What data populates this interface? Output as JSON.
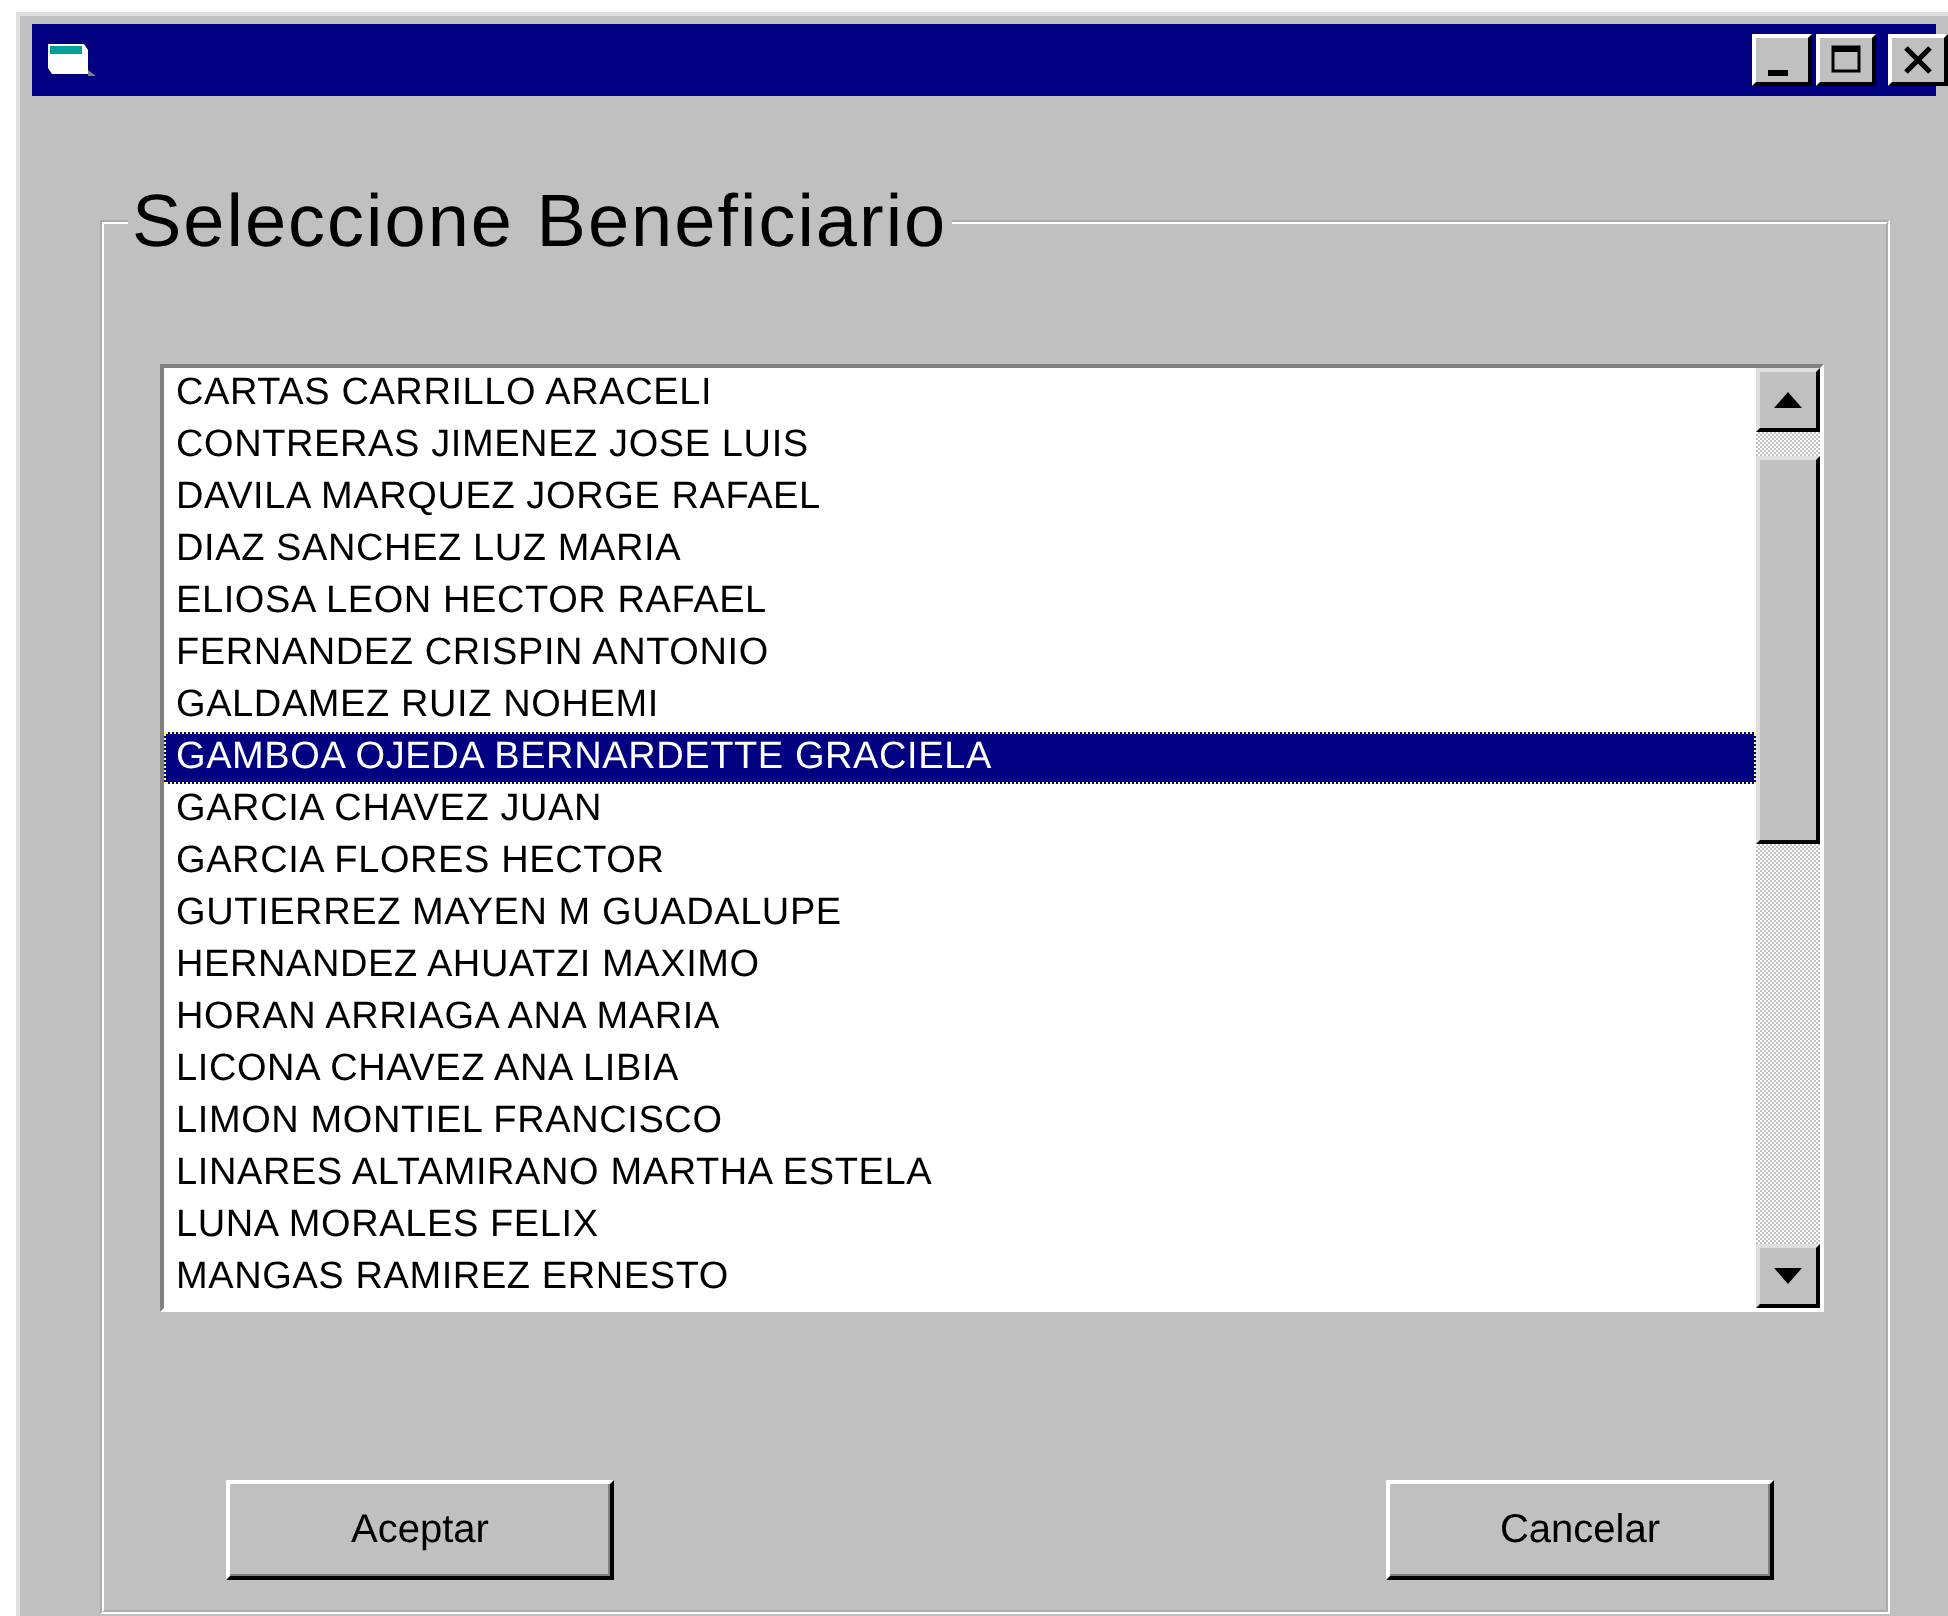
{
  "group_title": "Seleccione Beneficiario",
  "list_items": [
    {
      "label": "CARTAS CARRILLO ARACELI",
      "selected": false
    },
    {
      "label": "CONTRERAS JIMENEZ JOSE LUIS",
      "selected": false
    },
    {
      "label": "DAVILA MARQUEZ JORGE RAFAEL",
      "selected": false
    },
    {
      "label": "DIAZ SANCHEZ LUZ MARIA",
      "selected": false
    },
    {
      "label": "ELIOSA LEON HECTOR RAFAEL",
      "selected": false
    },
    {
      "label": "FERNANDEZ CRISPIN ANTONIO",
      "selected": false
    },
    {
      "label": "GALDAMEZ RUIZ NOHEMI",
      "selected": false
    },
    {
      "label": "GAMBOA OJEDA BERNARDETTE GRACIELA",
      "selected": true
    },
    {
      "label": "GARCIA CHAVEZ JUAN",
      "selected": false
    },
    {
      "label": "GARCIA FLORES HECTOR",
      "selected": false
    },
    {
      "label": "GUTIERREZ MAYEN M GUADALUPE",
      "selected": false
    },
    {
      "label": "HERNANDEZ AHUATZI MAXIMO",
      "selected": false
    },
    {
      "label": "HORAN ARRIAGA ANA MARIA",
      "selected": false
    },
    {
      "label": "LICONA CHAVEZ ANA LIBIA",
      "selected": false
    },
    {
      "label": "LIMON MONTIEL FRANCISCO",
      "selected": false
    },
    {
      "label": "LINARES ALTAMIRANO MARTHA ESTELA",
      "selected": false
    },
    {
      "label": "LUNA MORALES FELIX",
      "selected": false
    },
    {
      "label": "MANGAS RAMIREZ ERNESTO",
      "selected": false
    }
  ],
  "buttons": [
    {
      "label": "Aceptar"
    },
    {
      "label": "Cancelar"
    }
  ]
}
